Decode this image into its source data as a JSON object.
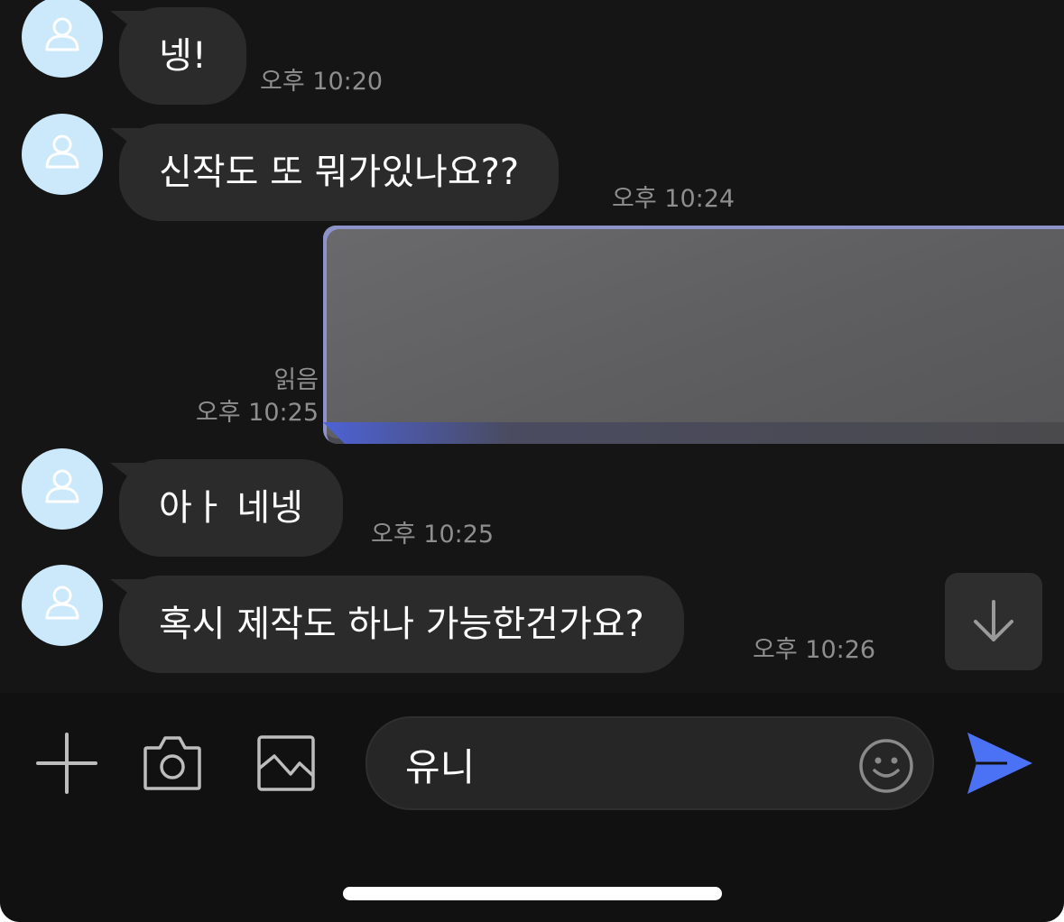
{
  "messages": [
    {
      "text": "넹!",
      "time": "오후 10:20"
    },
    {
      "text": "신작도 또 뭐가있나요??",
      "time": "오후 10:24"
    },
    {
      "text": "아ㅏ 네넹",
      "time": "오후 10:25"
    },
    {
      "text": "혹시 제작도 하나 가능한건가요?",
      "time": "오후 10:26"
    }
  ],
  "sent_image": {
    "read_status": "읽음",
    "time": "오후 10:25"
  },
  "composer": {
    "value": "유니"
  },
  "icons": {
    "avatar": "person-icon",
    "scroll": "arrow-down-icon",
    "add": "plus-icon",
    "camera": "camera-icon",
    "gallery": "image-icon",
    "emoji": "smiley-icon",
    "send": "send-icon"
  },
  "colors": {
    "background": "#151515",
    "bubble": "#2b2b2b",
    "avatar": "#cce9fb",
    "accent": "#4b72f5",
    "timestamp": "#8e8e8e"
  }
}
